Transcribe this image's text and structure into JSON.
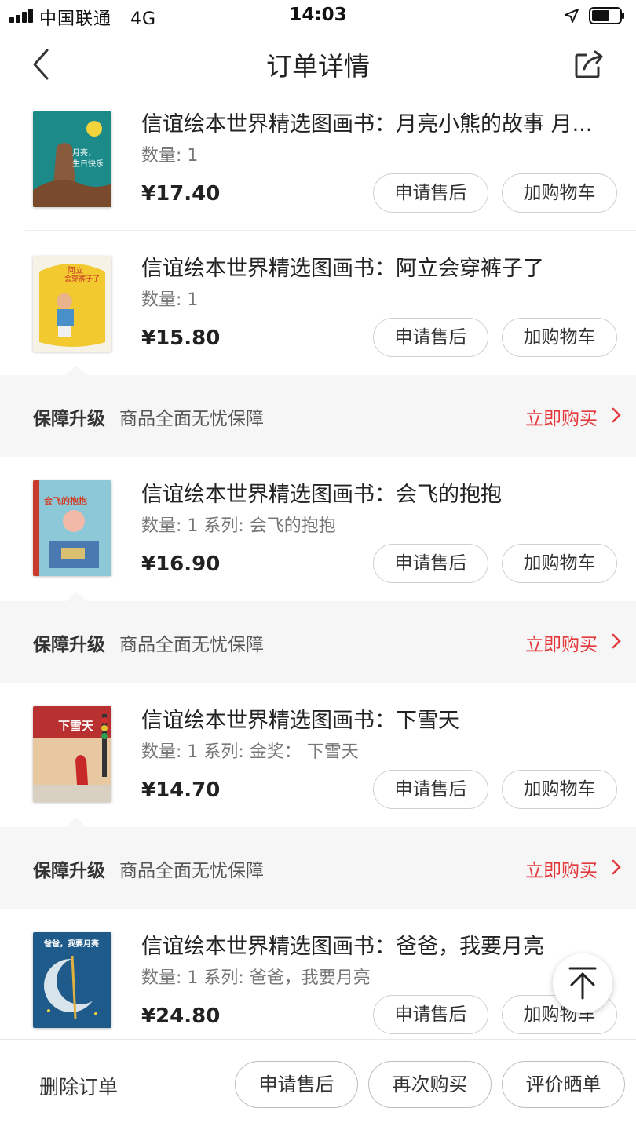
{
  "status_bar": {
    "carrier": "中国联通",
    "network": "4G",
    "time": "14:03"
  },
  "nav": {
    "title": "订单详情"
  },
  "products": [
    {
      "title": "信谊绘本世界精选图画书：月亮小熊的故事 月...",
      "meta": "数量: 1",
      "price": "¥17.40",
      "aftersale_label": "申请售后",
      "cart_label": "加购物车"
    },
    {
      "title": "信谊绘本世界精选图画书：阿立会穿裤子了",
      "meta": "数量: 1",
      "price": "¥15.80",
      "aftersale_label": "申请售后",
      "cart_label": "加购物车"
    },
    {
      "title": "信谊绘本世界精选图画书：会飞的抱抱",
      "meta": "数量: 1 系列: 会飞的抱抱",
      "price": "¥16.90",
      "aftersale_label": "申请售后",
      "cart_label": "加购物车"
    },
    {
      "title": "信谊绘本世界精选图画书：下雪天",
      "meta": "数量: 1 系列: 金奖：  下雪天",
      "price": "¥14.70",
      "aftersale_label": "申请售后",
      "cart_label": "加购物车"
    },
    {
      "title": "信谊绘本世界精选图画书：爸爸，我要月亮",
      "meta": "数量: 1 系列: 爸爸，我要月亮",
      "price": "¥24.80",
      "aftersale_label": "申请售后",
      "cart_label": "加购物车"
    }
  ],
  "protection": {
    "label": "保障升级",
    "desc": "商品全面无忧保障",
    "buy": "立即购买"
  },
  "covers": [
    {
      "text1": "月亮，",
      "text2": "生日快乐"
    },
    {
      "text1": "阿立",
      "text2": "会穿裤子了"
    },
    {
      "text1": "会飞的抱抱",
      "text2": ""
    },
    {
      "text1": "下雪天",
      "text2": ""
    },
    {
      "text1": "爸爸，我要月亮",
      "text2": ""
    }
  ],
  "bottom_bar": {
    "delete_label": "删除订单",
    "aftersale_label": "申请售后",
    "rebuy_label": "再次购买",
    "review_label": "评价晒单"
  },
  "colors": {
    "accent": "#e4393c",
    "banner_bg": "#f6f6f6",
    "text": "#222222"
  },
  "icons": [
    "back-icon",
    "share-icon",
    "location-icon",
    "battery-icon",
    "chevron-right-icon",
    "arrow-up-icon"
  ]
}
